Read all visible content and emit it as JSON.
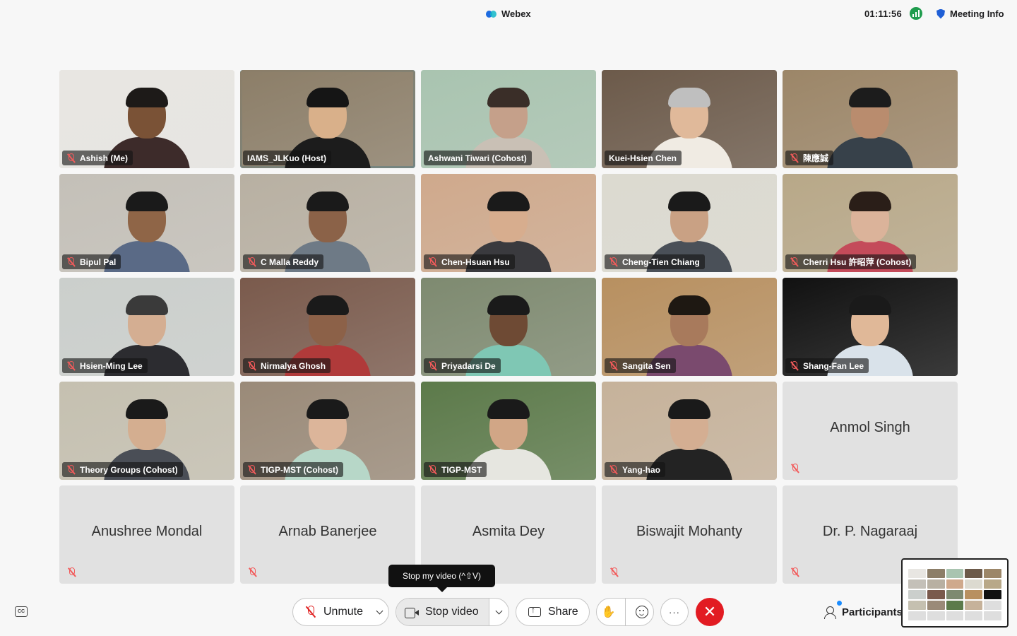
{
  "header": {
    "app_title": "Webex",
    "timer": "01:11:56",
    "meeting_info": "Meeting Info"
  },
  "tooltip": "Stop my video (^⇧V)",
  "toolbar": {
    "unmute_label": "Unmute",
    "stop_video_label": "Stop video",
    "share_label": "Share",
    "more_label": "···",
    "end_label": "✕",
    "participants_label": "Participants",
    "captions_label": "CC",
    "raise_hand_icon": "✋"
  },
  "tiles": [
    {
      "name": "Ashish  (Me)",
      "video": true,
      "muted": true,
      "bg": "#e8e6e2",
      "skin": "#7a5236",
      "hair": "#1d1a18",
      "shirt": "#3d2b2a"
    },
    {
      "name": "IAMS_JLKuo  (Host)",
      "video": true,
      "muted": false,
      "active": true,
      "bg": "#8c7e68",
      "skin": "#d9b08a",
      "hair": "#151515",
      "shirt": "#1c1c1c"
    },
    {
      "name": "Ashwani Tiwari  (Cohost)",
      "video": true,
      "muted": false,
      "bg": "#a9c4b0",
      "skin": "#c5a08a",
      "hair": "#3a2e28",
      "shirt": "#c9c0b5"
    },
    {
      "name": "Kuei-Hsien Chen",
      "video": true,
      "muted": false,
      "bg": "#6c5a4a",
      "skin": "#e0b99a",
      "hair": "#bfbfbf",
      "shirt": "#f0ebe3"
    },
    {
      "name": "陳應誠",
      "video": true,
      "muted": true,
      "bg": "#9c8668",
      "skin": "#b98c6e",
      "hair": "#1c1c1c",
      "shirt": "#37414a"
    },
    {
      "name": "Bipul Pal",
      "video": true,
      "muted": true,
      "bg": "#c4c0b8",
      "skin": "#8f6547",
      "hair": "#1a1a1a",
      "shirt": "#5a6a86"
    },
    {
      "name": "C Malla Reddy",
      "video": true,
      "muted": true,
      "bg": "#b8b0a2",
      "skin": "#8b6248",
      "hair": "#1a1a1a",
      "shirt": "#6e7a86"
    },
    {
      "name": "Chen-Hsuan Hsu",
      "video": true,
      "muted": true,
      "bg": "#cfa98c",
      "skin": "#d7ad8e",
      "hair": "#1a1a1a",
      "shirt": "#3a3a3e"
    },
    {
      "name": "Cheng-Tien Chiang",
      "video": true,
      "muted": true,
      "bg": "#dcdad0",
      "skin": "#c9a184",
      "hair": "#1a1a1a",
      "shirt": "#4a5058"
    },
    {
      "name": "Cherri Hsu 許昭萍  (Cohost)",
      "video": true,
      "muted": true,
      "bg": "#b8a888",
      "skin": "#dbb39a",
      "hair": "#2a1e18",
      "shirt": "#c44b5a"
    },
    {
      "name": "Hsien-Ming Lee",
      "video": true,
      "muted": true,
      "bg": "#cbcfcc",
      "skin": "#d4ae92",
      "hair": "#3a3a3a",
      "shirt": "#2c2c30"
    },
    {
      "name": "Nirmalya Ghosh",
      "video": true,
      "muted": true,
      "bg": "#7a5a4c",
      "skin": "#8c6148",
      "hair": "#1a1a1a",
      "shirt": "#b03a3a"
    },
    {
      "name": "Priyadarsi De",
      "video": true,
      "muted": true,
      "bg": "#7e8a70",
      "skin": "#6e4a34",
      "hair": "#1a1a1a",
      "shirt": "#7fc7b4"
    },
    {
      "name": "Sangita Sen",
      "video": true,
      "muted": true,
      "bg": "#b89060",
      "skin": "#a87a5c",
      "hair": "#1e1812",
      "shirt": "#7a4a6e"
    },
    {
      "name": "Shang-Fan Lee",
      "video": true,
      "muted": true,
      "bg": "#111111",
      "skin": "#e0b898",
      "hair": "#1a1a1a",
      "shirt": "#d9e2ea"
    },
    {
      "name": "Theory Groups  (Cohost)",
      "video": true,
      "muted": true,
      "bg": "#c5c0b0",
      "skin": "#d4ae90",
      "hair": "#1a1a1a",
      "shirt": "#4a4e56"
    },
    {
      "name": "TIGP-MST  (Cohost)",
      "video": true,
      "muted": true,
      "bg": "#9a8a78",
      "skin": "#dcb59a",
      "hair": "#1a1a1a",
      "shirt": "#b7d7c8"
    },
    {
      "name": "TIGP-MST",
      "video": true,
      "muted": true,
      "bg": "#5c7a4a",
      "skin": "#d1a686",
      "hair": "#1a1a1a",
      "shirt": "#e6e6e0"
    },
    {
      "name": "Yang-hao",
      "video": true,
      "muted": true,
      "bg": "#c6b29a",
      "skin": "#d4ae92",
      "hair": "#1a1a1a",
      "shirt": "#232323"
    },
    {
      "name": "Anmol Singh",
      "video": false,
      "muted": true
    },
    {
      "name": "Anushree Mondal",
      "video": false,
      "muted": true
    },
    {
      "name": "Arnab Banerjee",
      "video": false,
      "muted": true
    },
    {
      "name": "Asmita Dey",
      "video": false,
      "muted": true
    },
    {
      "name": "Biswajit Mohanty",
      "video": false,
      "muted": true
    },
    {
      "name": "Dr. P. Nagaraaj",
      "video": false,
      "muted": true
    }
  ],
  "icons": {
    "mute": "mic-off-icon",
    "camera": "camera-icon",
    "share": "share-screen-icon",
    "reactions": "reactions-icon",
    "participants": "participants-icon",
    "captions": "closed-captions-icon"
  },
  "colors": {
    "active_speaker": "#1aa3e8",
    "end_call": "#e21b22",
    "mute_red": "#e02020"
  }
}
